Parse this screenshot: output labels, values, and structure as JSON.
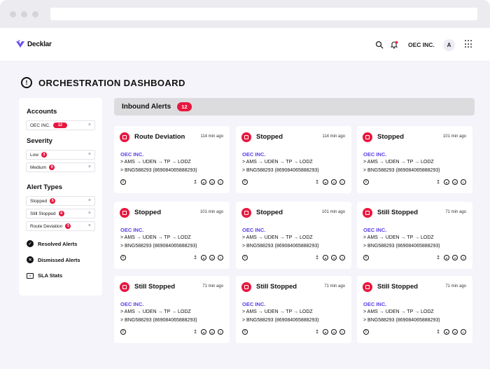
{
  "header": {
    "brand": "Decklar",
    "org_name": "OEC INC.",
    "avatar_initial": "A"
  },
  "page": {
    "title": "ORCHESTRATION DASHBOARD"
  },
  "sidebar": {
    "accounts_heading": "Accounts",
    "accounts": [
      {
        "label": "OEC INC.",
        "count": "12"
      }
    ],
    "severity_heading": "Severity",
    "severity": [
      {
        "label": "Low",
        "count": "3"
      },
      {
        "label": "Medium",
        "count": "9"
      }
    ],
    "alert_types_heading": "Alert Types",
    "alert_types": [
      {
        "label": "Stopped",
        "count": "5"
      },
      {
        "label": "Still Stopped",
        "count": "4"
      },
      {
        "label": "Route Deviation",
        "count": "3"
      }
    ],
    "links": [
      {
        "label": "Resolved Alerts"
      },
      {
        "label": "Dismissed Alerts"
      },
      {
        "label": "SLA Stats"
      }
    ]
  },
  "inbound": {
    "label": "Inbound Alerts",
    "count": "12"
  },
  "cards": [
    {
      "title": "Route Deviation",
      "time": "114 min ago",
      "org": "OEC INC.",
      "route": "> AMS → UDEN → TP → LODZ",
      "device": "> BNG588293 (869084065888293)"
    },
    {
      "title": "Stopped",
      "time": "114 min ago",
      "org": "OEC INC.",
      "route": "> AMS → UDEN → TP → LODZ",
      "device": "> BNG588293 (869084065888293)"
    },
    {
      "title": "Stopped",
      "time": "101 min ago",
      "org": "OEC INC.",
      "route": "> AMS → UDEN → TP → LODZ",
      "device": "> BNG588293 (869084065888293)"
    },
    {
      "title": "Stopped",
      "time": "101 min ago",
      "org": "OEC INC.",
      "route": "> AMS → UDEN → TP → LODZ",
      "device": "> BNG588293 (869084065888293)"
    },
    {
      "title": "Stopped",
      "time": "101 min ago",
      "org": "OEC INC.",
      "route": "> AMS → UDEN → TP → LODZ",
      "device": "> BNG588293 (869084065888293)"
    },
    {
      "title": "Still Stopped",
      "time": "71 min ago",
      "org": "OEC INC.",
      "route": "> AMS → UDEN → TP → LODZ",
      "device": "> BNG588293 (869084065888293)"
    },
    {
      "title": "Still Stopped",
      "time": "71 min ago",
      "org": "OEC INC.",
      "route": "> AMS → UDEN → TP → LODZ",
      "device": "> BNG588293 (869084065888293)"
    },
    {
      "title": "Still Stopped",
      "time": "71 min ago",
      "org": "OEC INC.",
      "route": "> AMS → UDEN → TP → LODZ",
      "device": "> BNG588293 (869084065888293)"
    },
    {
      "title": "Still Stopped",
      "time": "71 min ago",
      "org": "OEC INC.",
      "route": "> AMS → UDEN → TP → LODZ",
      "device": "> BNG588293 (869084065888293)"
    }
  ],
  "colors": {
    "alert_red": "#e8173f",
    "org_purple": "#5b3ee8",
    "background": "#f5f4fa"
  }
}
